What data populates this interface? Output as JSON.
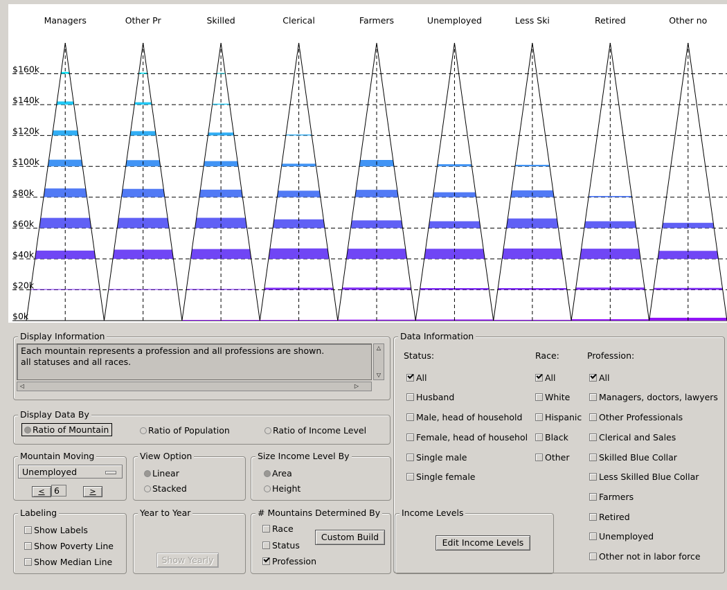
{
  "chart_data": {
    "type": "bar",
    "title": "",
    "categories": [
      "Managers",
      "Other Pr",
      "Skilled",
      "Clerical",
      "Farmers",
      "Unemployed",
      "Less Ski",
      "Retired",
      "Other no"
    ],
    "y_ticks": [
      "$0k",
      "$20k",
      "$40k",
      "$60k",
      "$80k",
      "$100k",
      "$120k",
      "$140k",
      "$160k"
    ],
    "ylim": [
      0,
      180
    ],
    "income_levels_k": [
      0,
      20,
      40,
      60,
      80,
      100,
      120,
      140,
      160
    ],
    "series_ratio_of_mountain": [
      {
        "name": "Managers",
        "values": [
          0.0,
          0.02,
          0.79,
          0.97,
          0.83,
          0.63,
          0.48,
          0.3,
          0.18
        ]
      },
      {
        "name": "Other Pr",
        "values": [
          0.0,
          0.01,
          0.88,
          0.97,
          0.79,
          0.59,
          0.41,
          0.23,
          0.11
        ]
      },
      {
        "name": "Skilled",
        "values": [
          0.05,
          0.07,
          0.94,
          0.98,
          0.72,
          0.5,
          0.28,
          0.09,
          0.02
        ]
      },
      {
        "name": "Clerical",
        "values": [
          0.06,
          0.19,
          1.0,
          0.83,
          0.62,
          0.25,
          0.09,
          0.0,
          0.0
        ]
      },
      {
        "name": "Farmers",
        "values": [
          0.09,
          0.21,
          0.97,
          0.73,
          0.7,
          0.61,
          0.0,
          0.0,
          0.0
        ]
      },
      {
        "name": "Unemployed",
        "values": [
          0.11,
          0.16,
          0.96,
          0.65,
          0.47,
          0.2,
          0.0,
          0.0,
          0.0
        ]
      },
      {
        "name": "Less Ski",
        "values": [
          0.07,
          0.16,
          0.99,
          0.91,
          0.65,
          0.15,
          0.0,
          0.0,
          0.0
        ]
      },
      {
        "name": "Retired",
        "values": [
          0.13,
          0.21,
          0.97,
          0.65,
          0.12,
          0.0,
          0.0,
          0.0,
          0.0
        ]
      },
      {
        "name": "Other no",
        "values": [
          0.27,
          0.18,
          0.77,
          0.5,
          0.0,
          0.0,
          0.0,
          0.0,
          0.0
        ]
      }
    ],
    "colors": {
      "low": "#8f12f5",
      "high": "#12e2f5",
      "outline": "#000000",
      "gridline": "#000000"
    },
    "grid": true,
    "gridline_style": "dashed"
  },
  "display_information": {
    "title": "Display Information",
    "text_line1": "Each mountain represents a profession and all professions are shown.",
    "text_line2": "all statuses and all races."
  },
  "display_data_by": {
    "title": "Display Data By",
    "options": [
      "Ratio of Mountain",
      "Ratio of Population",
      "Ratio of Income Level"
    ],
    "selected": "Ratio of Mountain"
  },
  "mountain_moving": {
    "title": "Mountain Moving",
    "selected": "Unemployed",
    "step_value": "6",
    "prev_label": "<",
    "next_label": ">"
  },
  "view_option": {
    "title": "View Option",
    "options": [
      "Linear",
      "Stacked"
    ],
    "selected": "Linear"
  },
  "size_income": {
    "title": "Size Income Level By",
    "options": [
      "Area",
      "Height"
    ],
    "selected": "Area"
  },
  "labeling": {
    "title": "Labeling",
    "options": [
      "Show Labels",
      "Show Poverty Line",
      "Show Median Line"
    ]
  },
  "year_to_year": {
    "title": "Year to Year",
    "button": "Show Yearly"
  },
  "mountains_determined": {
    "title": "# Mountains Determined By",
    "options": [
      "Race",
      "Status",
      "Profession"
    ],
    "checked": "Profession",
    "button": "Custom Build"
  },
  "data_information": {
    "title": "Data Information",
    "status_label": "Status:",
    "race_label": "Race:",
    "profession_label": "Profession:",
    "status_items": [
      "All",
      "Husband",
      "Male, head of household",
      "Female, head of househol",
      "Single male",
      "Single female"
    ],
    "race_items": [
      "All",
      "White",
      "Hispanic",
      "Black",
      "Other"
    ],
    "profession_items": [
      "All",
      "Managers, doctors, lawyers",
      "Other Professionals",
      "Clerical and Sales",
      "Skilled Blue Collar",
      "Less Skilled Blue Collar",
      "Farmers",
      "Retired",
      "Unemployed",
      "Other not in labor force"
    ]
  },
  "income_levels": {
    "title": "Income Levels",
    "button": "Edit Income Levels"
  }
}
